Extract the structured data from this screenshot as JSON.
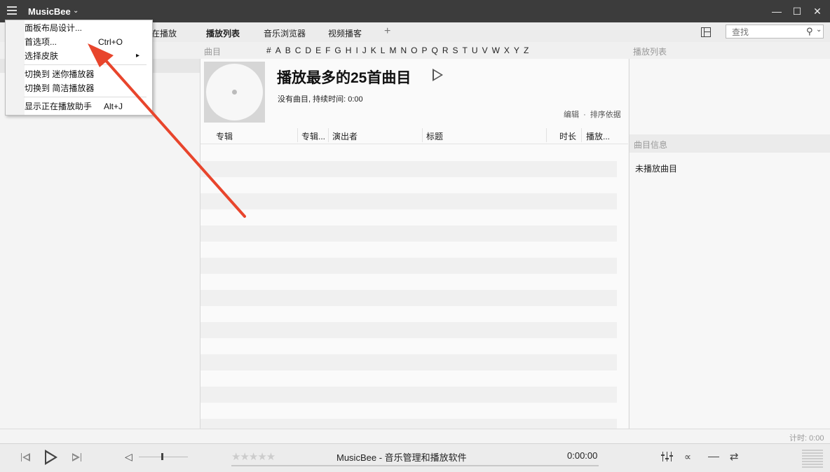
{
  "titlebar": {
    "title": "MusicBee",
    "minimize": "—",
    "maximize": "☐",
    "close": "✕"
  },
  "tabs": {
    "now_playing": "正在播放",
    "playlist": "播放列表",
    "music_browser": "音乐浏览器",
    "video": "视频播客",
    "add": "+"
  },
  "search": {
    "placeholder": "查找"
  },
  "subheader": {
    "tracks_label": "曲目",
    "alphabet": [
      "#",
      "A",
      "B",
      "C",
      "D",
      "E",
      "F",
      "G",
      "H",
      "I",
      "J",
      "K",
      "L",
      "M",
      "N",
      "O",
      "P",
      "Q",
      "R",
      "S",
      "T",
      "U",
      "V",
      "W",
      "X",
      "Y",
      "Z"
    ],
    "playlist_label": "播放列表"
  },
  "main": {
    "title": "播放最多的25首曲目",
    "track_info": "没有曲目, 持续时间: 0:00",
    "edit": "编辑",
    "dot": "·",
    "sort": "排序依据",
    "columns": {
      "album": "专辑",
      "album_more": "专辑...",
      "artist": "演出者",
      "title": "标题",
      "duration": "时长",
      "plays": "播放..."
    }
  },
  "right": {
    "track_info_header": "曲目信息",
    "not_playing": "未播放曲目"
  },
  "status": {
    "timer": "计时: 0:00"
  },
  "player": {
    "now_playing_text": "MusicBee - 音乐管理和播放软件",
    "time": "0:00:00",
    "rating": "★★★★★"
  },
  "menu": {
    "items": [
      {
        "label": "面板布局设计...",
        "shortcut": ""
      },
      {
        "label": "首选项...",
        "shortcut": "Ctrl+O"
      },
      {
        "label": "选择皮肤",
        "shortcut": "▸"
      },
      {
        "label": "切换到 迷你播放器",
        "shortcut": ""
      },
      {
        "label": "切换到 简洁播放器",
        "shortcut": ""
      },
      {
        "label": "显示正在播放助手",
        "shortcut": "Alt+J"
      }
    ]
  },
  "colors": {
    "annotation_arrow": "#e8452c",
    "titlebar": "#3c3c3c"
  }
}
